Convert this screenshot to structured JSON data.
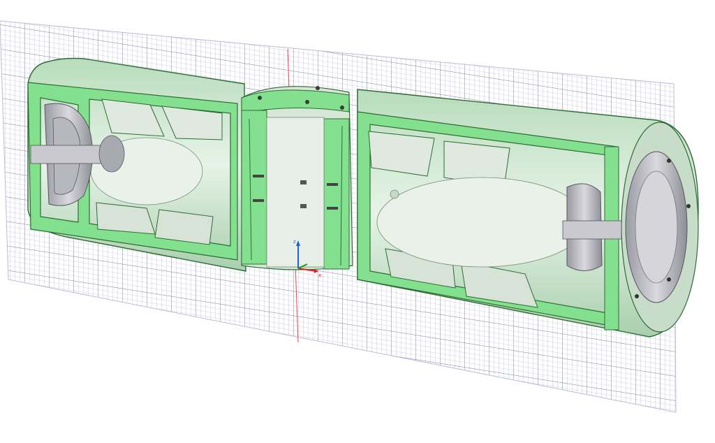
{
  "viewport": {
    "background": "#ffffff",
    "grid_color": "#8c93b8",
    "grid_major_color": "#5f6790",
    "section_fill": "#83e08f",
    "section_edge": "#2e6b34",
    "body_fill": "#d6ecd8",
    "metal_fill": "#c9c9cf",
    "metal_dark": "#8f8f98"
  },
  "axes": {
    "z_label": "z",
    "x_label": "x",
    "z_color": "#1f5fe0",
    "x_color": "#e02020",
    "y_color": "#1a9a2a"
  },
  "model": {
    "parts": [
      "left-speaker-driver",
      "left-enclosure",
      "center-mount-bracket",
      "right-enclosure",
      "right-speaker-driver"
    ]
  }
}
